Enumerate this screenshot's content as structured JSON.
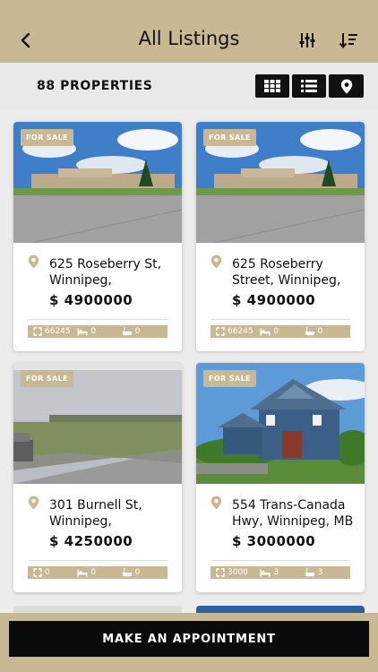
{
  "header": {
    "title": "All Listings"
  },
  "toolbar": {
    "count": "88 PROPERTIES"
  },
  "listings": [
    {
      "badge": "FOR SALE",
      "address": "625 Roseberry St, Winnipeg,",
      "price": "$ 4900000",
      "area": "66245",
      "beds": "0",
      "baths": "0"
    },
    {
      "badge": "FOR SALE",
      "address": "625 Roseberry Street, Winnipeg,",
      "price": "$ 4900000",
      "area": "66245",
      "beds": "0",
      "baths": "0"
    },
    {
      "badge": "FOR SALE",
      "address": "301 Burnell St, Winnipeg,",
      "price": "$ 4250000",
      "area": "0",
      "beds": "0",
      "baths": "0"
    },
    {
      "badge": "FOR SALE",
      "address": "554 Trans-Canada Hwy, Winnipeg, MB",
      "price": "$ 3000000",
      "area": "3000",
      "beds": "3",
      "baths": "3"
    }
  ],
  "footer": {
    "cta": "MAKE AN APPOINTMENT"
  },
  "colors": {
    "accent": "#c8b994",
    "dark": "#111111",
    "background": "#ececec"
  }
}
